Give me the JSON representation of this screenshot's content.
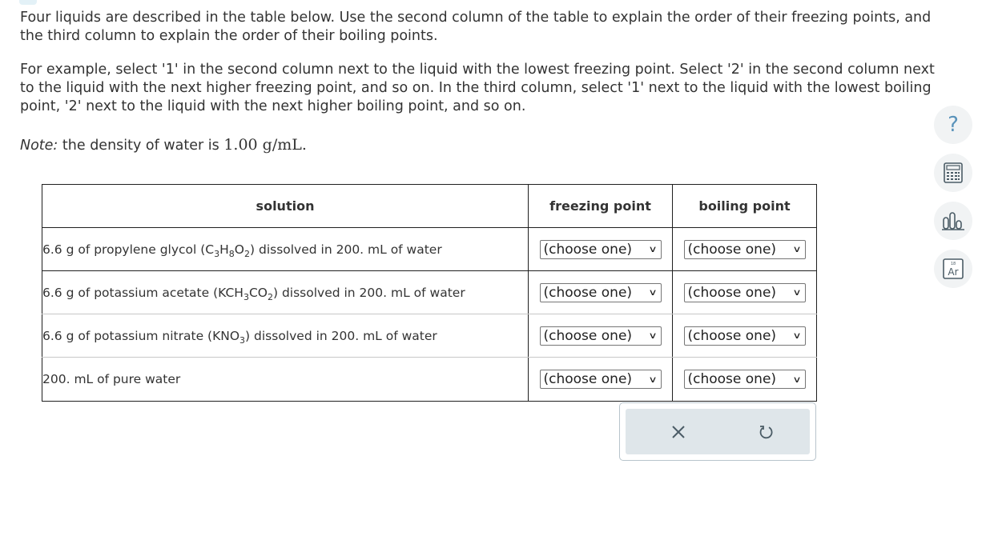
{
  "instructions": {
    "para1": "Four liquids are described in the table below. Use the second column of the table to explain the order of their freezing points, and the third column to explain the order of their boiling points.",
    "para2": "For example, select '1' in the second column next to the liquid with the lowest freezing point. Select '2' in the second column next to the liquid with the next higher freezing point, and so on. In the third column, select '1' next to the liquid with the lowest boiling point, '2' next to the liquid with the next higher boiling point, and so on.",
    "note_label": "Note:",
    "note_text": "the density of water is",
    "note_value": "1.00 g/mL",
    "note_end": "."
  },
  "table": {
    "headers": [
      "solution",
      "freezing point",
      "boiling point"
    ],
    "rows": [
      {
        "pre": "6.6 g of propylene glycol (C",
        "formula": [
          [
            "3",
            "H"
          ],
          [
            "8",
            "O"
          ],
          [
            "2",
            ""
          ]
        ],
        "post": ") dissolved in 200. mL of water",
        "fp": "(choose one)",
        "bp": "(choose one)"
      },
      {
        "pre": "6.6 g of potassium acetate (KCH",
        "formula": [
          [
            "3",
            "CO"
          ],
          [
            "2",
            ""
          ]
        ],
        "post": ") dissolved in 200. mL of water",
        "fp": "(choose one)",
        "bp": "(choose one)"
      },
      {
        "pre": "6.6 g of potassium nitrate (KNO",
        "formula": [
          [
            "3",
            ""
          ]
        ],
        "post": ") dissolved in 200. mL of water",
        "fp": "(choose one)",
        "bp": "(choose one)"
      },
      {
        "pre": "200. mL of pure water",
        "formula": [],
        "post": "",
        "fp": "(choose one)",
        "bp": "(choose one)"
      }
    ]
  },
  "actions": {
    "clear_icon": "close-icon",
    "reset_icon": "undo-icon"
  },
  "tools": [
    "help-icon",
    "calculator-icon",
    "data-chart-icon",
    "periodic-table-icon"
  ],
  "periodic_tile": {
    "number": "18",
    "symbol": "Ar"
  },
  "colors": {
    "help_accent": "#5a93ba",
    "action_bg": "#dfe6ea",
    "tool_bg": "#f1f3f4"
  }
}
